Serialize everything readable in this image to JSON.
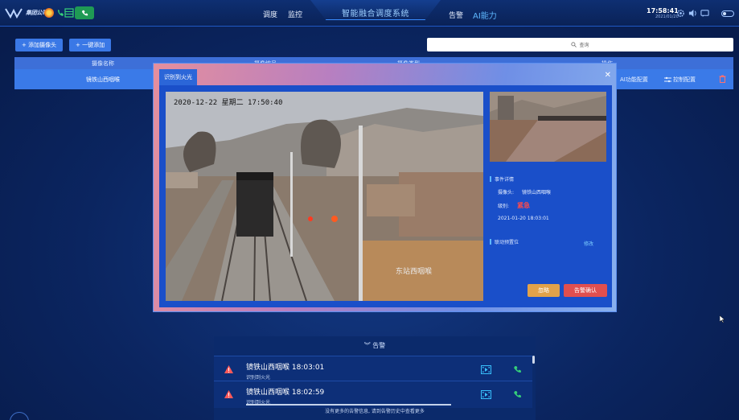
{
  "topbar": {
    "logo_text": "集团公司",
    "nav_left": [
      "调度",
      "监控"
    ],
    "system_title": "智能融合调度系统",
    "alarm_label": "告警",
    "ai_label": "AI能力",
    "time": "17:58:41",
    "date": "2021/01/20"
  },
  "toolbar": {
    "add_camera": "+ 添加摄像头",
    "one_key_add": "+ 一键添加",
    "search_placeholder": "查询"
  },
  "table": {
    "headers": [
      "摄像名称",
      "摄像编号",
      "摄像类型",
      "操作"
    ],
    "rows": [
      {
        "name": "镜铁山西咽喉",
        "ai_config": "AI功能配置",
        "control_config": "控制配置"
      }
    ]
  },
  "modal": {
    "tab_label": "识别到火光",
    "video_timestamp": "2020-12-22 星期二 17:50:40",
    "video_caption": "东站西咽喉",
    "detail_title": "事件详情",
    "camera_label": "摄像头:",
    "camera_value": "镜铁山西咽喉",
    "level_label": "级别:",
    "level_value": "紧急",
    "event_time": "2021-01-20 18:03:01",
    "linkage_label": "联动预置位",
    "edit_label": "修改",
    "ignore_button": "忽略",
    "confirm_button": "告警确认"
  },
  "alarm_panel": {
    "header": "告警",
    "items": [
      {
        "title": "镜铁山西咽喉  18:03:01",
        "subtitle": "识别到火光"
      },
      {
        "title": "镜铁山西咽喉  18:02:59",
        "subtitle": "识别到火光"
      }
    ],
    "footnote": "没有更多的告警信息, 请到告警历史中查看更多"
  },
  "colors": {
    "accent": "#3a78e6",
    "danger": "#e14f4f",
    "warning": "#e2a24a",
    "call_green": "#1f9a54"
  }
}
